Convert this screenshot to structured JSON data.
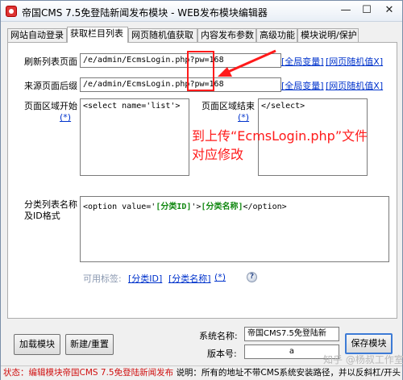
{
  "window": {
    "title": "帝国CMS 7.5免登陆新闻发布模块 - WEB发布模块编辑器",
    "minimize": "—",
    "maximize": "☐",
    "close": "✕"
  },
  "tabs": [
    {
      "label": "网站自动登录"
    },
    {
      "label": "获取栏目列表"
    },
    {
      "label": "网页随机值获取"
    },
    {
      "label": "内容发布参数"
    },
    {
      "label": "高级功能"
    },
    {
      "label": "模块说明/保护"
    }
  ],
  "form": {
    "refresh_label": "刷新列表页面",
    "refresh_value": "/e/admin/EcmsLogin.php?pw=168",
    "source_label": "来源页面后缀",
    "source_value": "/e/admin/EcmsLogin.php?pw=168",
    "global_var_link": "[全局变量]",
    "random_val_link": "[网页随机值X]",
    "region_start_label": "页面区域开始",
    "region_start_value": "<select name='list'>",
    "region_end_label": "页面区域结束",
    "region_end_value": "</select>",
    "star_link": "(*)",
    "category_label_1": "分类列表名称",
    "category_label_2": "及ID格式",
    "category_pre": "<option value='",
    "category_id": "[分类ID]",
    "category_mid": "'>",
    "category_name": "[分类名称]",
    "category_post": "</option>",
    "available_tags_label": "可用标签:",
    "tag_id": "[分类ID]",
    "tag_name": "[分类名称]",
    "tag_star": "(*)",
    "help_icon_text": "?"
  },
  "annotation": {
    "line1": "到上传“EcmsLogin.php”文件",
    "line2": "对应修改"
  },
  "bottom": {
    "load_button": "加载模块",
    "new_reset_button": "新建/重置",
    "system_name_label": "系统名称:",
    "system_name_value": "帝国CMS7.5免登陆新",
    "version_label": "版本号:",
    "version_value": "a",
    "save_button": "保存模块"
  },
  "status": {
    "prefix": "状态：编辑模块帝国CMS 7.5免登陆新闻发布",
    "suffix": "说明：所有的地址不带CMS系统安装路径，并以反斜杠/开头"
  },
  "watermark": "知乎 @杨叔工作室",
  "colors": {
    "annotation": "#ff1a1a",
    "link": "#0033cc",
    "highlight": "#118811",
    "status_red": "#d01010"
  }
}
